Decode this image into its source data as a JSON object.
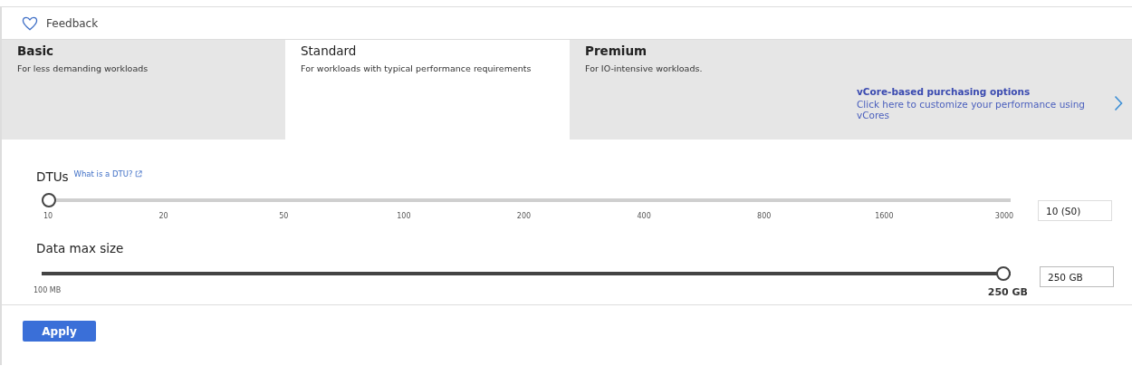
{
  "toolbar": {
    "feedback": "Feedback"
  },
  "tiers": [
    {
      "name": "Basic",
      "description": "For less demanding workloads",
      "selected": false
    },
    {
      "name": "Standard",
      "description": "For workloads with typical performance requirements",
      "selected": true
    },
    {
      "name": "Premium",
      "description": "For IO-intensive workloads.",
      "selected": false
    }
  ],
  "vcore_link": {
    "title": "vCore-based purchasing options",
    "text": "Click here to customize your performance using vCores"
  },
  "dtu": {
    "label": "DTUs",
    "help_link": "What is a DTU?",
    "level": 0,
    "ticks": [
      "10",
      "20",
      "50",
      "100",
      "200",
      "400",
      "800",
      "1600",
      "3000"
    ],
    "value": "10 (S0)"
  },
  "data_size": {
    "label": "Data max size",
    "level": 1,
    "min_label": "100 MB",
    "current_label": "250 GB",
    "value": "250 GB"
  },
  "apply_button": "Apply"
}
